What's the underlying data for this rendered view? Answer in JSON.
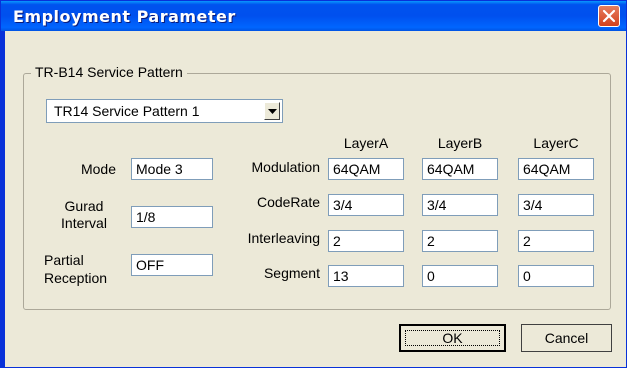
{
  "window": {
    "title": "Employment Parameter"
  },
  "group": {
    "label": "TR-B14 Service Pattern"
  },
  "service_pattern": {
    "selected": "TR14 Service Pattern 1"
  },
  "labels": {
    "mode": "Mode",
    "guard_interval_1": "Gurad",
    "guard_interval_2": "Interval",
    "partial_reception_1": "Partial",
    "partial_reception_2": "Reception",
    "modulation": "Modulation",
    "coderate": "CodeRate",
    "interleaving": "Interleaving",
    "segment": "Segment"
  },
  "fields": {
    "mode": "Mode 3",
    "guard_interval": "1/8",
    "partial_reception": "OFF"
  },
  "layers": [
    {
      "name": "LayerA",
      "modulation": "64QAM",
      "coderate": "3/4",
      "interleaving": "2",
      "segment": "13"
    },
    {
      "name": "LayerB",
      "modulation": "64QAM",
      "coderate": "3/4",
      "interleaving": "2",
      "segment": "0"
    },
    {
      "name": "LayerC",
      "modulation": "64QAM",
      "coderate": "3/4",
      "interleaving": "2",
      "segment": "0"
    }
  ],
  "buttons": {
    "ok": "OK",
    "cancel": "Cancel"
  },
  "icons": {
    "close": "close-icon",
    "dropdown": "chevron-down-icon"
  }
}
